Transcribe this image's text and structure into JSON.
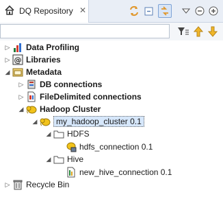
{
  "tab": {
    "title": "DQ Repository",
    "close_glyph": "✕",
    "home_icon": "home-icon"
  },
  "toolbar": {
    "buttons": [
      "sync-icon",
      "collapse-all-icon",
      "link-with-editor-icon",
      "view-menu-icon",
      "minimize-icon",
      "maximize-icon"
    ]
  },
  "filter": {
    "value": "",
    "placeholder": "",
    "buttons": [
      "filter-icon",
      "arrow-up-icon",
      "arrow-down-icon"
    ]
  },
  "tree": {
    "data_profiling": "Data Profiling",
    "libraries": "Libraries",
    "metadata": "Metadata",
    "db_connections": "DB connections",
    "file_delimited": "FileDelimited connections",
    "hadoop_cluster": "Hadoop Cluster",
    "my_cluster": "my_hadoop_cluster 0.1",
    "hdfs": "HDFS",
    "hdfs_connection": "hdfs_connection 0.1",
    "hive": "Hive",
    "hive_connection": "new_hive_connection 0.1",
    "recycle_bin": "Recycle Bin"
  },
  "colors": {
    "selection": "#d6e7fb",
    "accent": "#2f6fd1",
    "folder": "#e8c23a"
  }
}
